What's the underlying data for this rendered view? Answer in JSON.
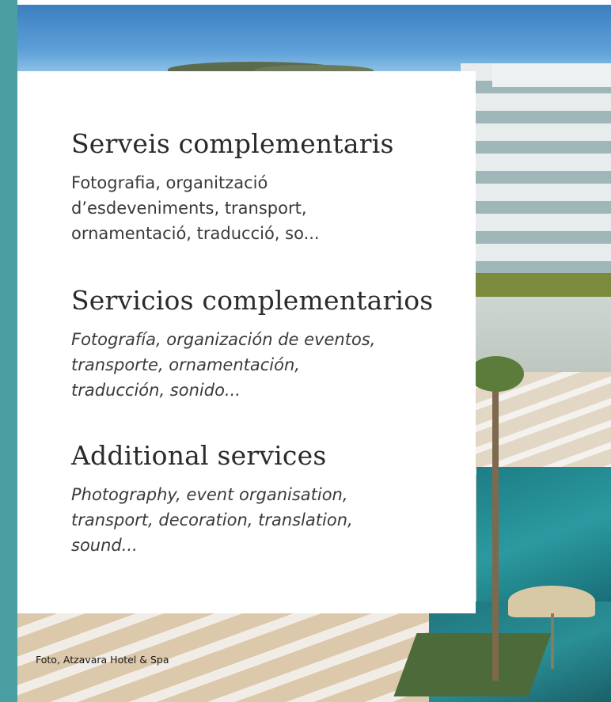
{
  "sections": [
    {
      "title": "Serveis complementaris",
      "text": "Fotografia, organització\nd’esdeveniments, transport,\nornamentació, traducció, so..."
    },
    {
      "title": "Servicios complementarios",
      "text": "Fotografía, organización de eventos,\ntransporte, ornamentación,\ntraducción, sonido..."
    },
    {
      "title": "Additional services",
      "text": "Photography, event organisation,\ntransport, decoration, translation,\nsound..."
    }
  ],
  "photo_credit": "Foto, Atzavara Hotel & Spa",
  "colors": {
    "accent_strip": "#4a9fa3",
    "card": "#ffffff",
    "text": "#3a3a3a"
  }
}
